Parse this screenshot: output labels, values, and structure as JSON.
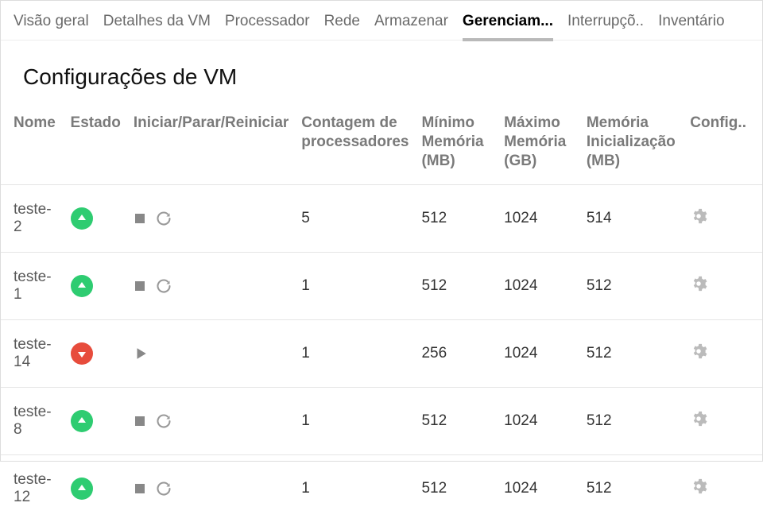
{
  "tabs": [
    {
      "label": "Visão geral",
      "active": false
    },
    {
      "label": "Detalhes da VM",
      "active": false
    },
    {
      "label": "Processador",
      "active": false
    },
    {
      "label": "Rede",
      "active": false
    },
    {
      "label": "Armazenar",
      "active": false
    },
    {
      "label": "Gerenciam...",
      "active": true
    },
    {
      "label": "Interrupçõ..",
      "active": false
    },
    {
      "label": "Inventário",
      "active": false
    }
  ],
  "page": {
    "title": "Configurações de VM"
  },
  "headers": {
    "name": "Nome",
    "state": "Estado",
    "actions": "Iniciar/Parar/Reiniciar",
    "proc": "Contagem de processadores",
    "min_mem": "Mínimo Memória (MB)",
    "max_mem": "Máximo Memória (GB)",
    "init_mem": "Memória Inicialização (MB)",
    "config": "Config.."
  },
  "rows": [
    {
      "name": "teste-2",
      "state": "up",
      "proc": "5",
      "min_mem": "512",
      "max_mem": "1024",
      "init_mem": "514"
    },
    {
      "name": "teste-1",
      "state": "up",
      "proc": "1",
      "min_mem": "512",
      "max_mem": "1024",
      "init_mem": "512"
    },
    {
      "name": "teste-14",
      "state": "down",
      "proc": "1",
      "min_mem": "256",
      "max_mem": "1024",
      "init_mem": "512"
    },
    {
      "name": "teste-8",
      "state": "up",
      "proc": "1",
      "min_mem": "512",
      "max_mem": "1024",
      "init_mem": "512"
    },
    {
      "name": "teste-12",
      "state": "up",
      "proc": "1",
      "min_mem": "512",
      "max_mem": "1024",
      "init_mem": "512"
    }
  ]
}
